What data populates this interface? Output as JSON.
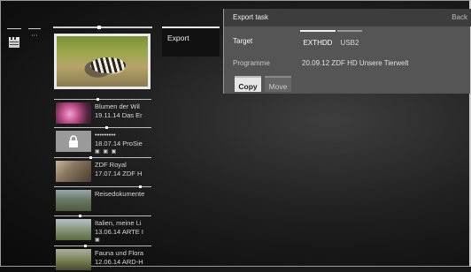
{
  "left_column": {
    "dots": "···",
    "icon": "clapperboard-icon"
  },
  "export_tab": {
    "label": "Export"
  },
  "export_panel": {
    "title": "Export task",
    "back_label": "Back",
    "target_label": "Target",
    "target_options": [
      "EXTHDD",
      "USB2"
    ],
    "target_selected": "EXTHDD",
    "programme_label": "Programme",
    "programme_value": "20.09.12 ZDF HD Unsere Tierwelt",
    "copy_label": "Copy",
    "move_label": "Move"
  },
  "recordings": [
    {
      "title": "Blumen der Wil",
      "subtitle": "19.11.14 Das Er",
      "flags": ""
    },
    {
      "title": "•••••••••",
      "subtitle": "18.07.14 ProSie",
      "flags": "▣ ▣ ▣",
      "locked": true
    },
    {
      "title": "ZDF Royal",
      "subtitle": "17.07.14 ZDF H",
      "flags": ""
    },
    {
      "title": "Reisedokumente",
      "subtitle": "",
      "flags": ""
    },
    {
      "title": "Italien, meine Li",
      "subtitle": "13.06.14 ARTE I",
      "flags": "▣"
    },
    {
      "title": "Fauna und Flora",
      "subtitle": "12.06.14 ARD-H",
      "flags": ""
    }
  ]
}
